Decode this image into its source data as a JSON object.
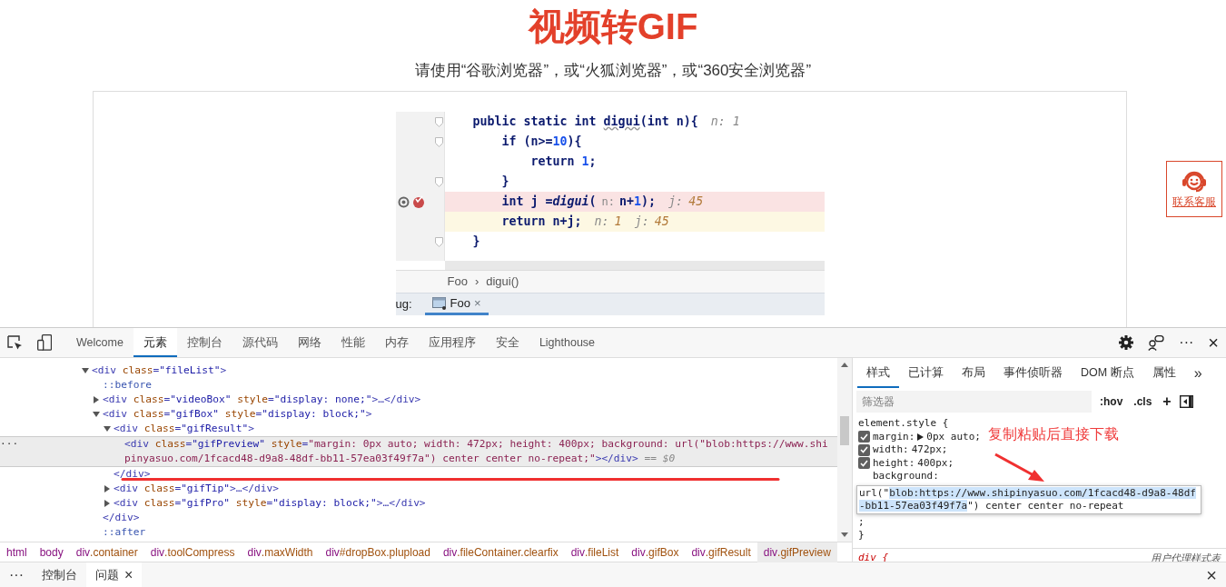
{
  "page": {
    "title": "视频转GIF",
    "subtitle": "请使用“谷歌浏览器”，或“火狐浏览器”，或“360安全浏览器”",
    "contact_label": "联系客服"
  },
  "preview": {
    "code_lines": [
      {
        "kind": "normal",
        "fold": true,
        "segments": [
          {
            "kind": "code",
            "text": "public static int "
          },
          {
            "kind": "squiggle",
            "text": "digui"
          },
          {
            "kind": "code",
            "text": "(int n){"
          },
          {
            "kind": "hint",
            "text": "n: 1"
          }
        ]
      },
      {
        "kind": "normal",
        "fold": true,
        "segments": [
          {
            "kind": "code",
            "text": "    if (n>="
          },
          {
            "kind": "number",
            "text": "10"
          },
          {
            "kind": "code",
            "text": "){"
          }
        ]
      },
      {
        "kind": "normal",
        "fold": false,
        "segments": [
          {
            "kind": "code",
            "text": "        return "
          },
          {
            "kind": "number",
            "text": "1"
          },
          {
            "kind": "code",
            "text": ";"
          }
        ]
      },
      {
        "kind": "normal",
        "fold": true,
        "segments": [
          {
            "kind": "code",
            "text": "    }"
          }
        ]
      },
      {
        "kind": "breakpoint",
        "fold": false,
        "segments": [
          {
            "kind": "code",
            "text": "    int j ="
          },
          {
            "kind": "call",
            "text": "digui"
          },
          {
            "kind": "code",
            "text": "("
          },
          {
            "kind": "param",
            "text": "n:"
          },
          {
            "kind": "code",
            "text": "n+"
          },
          {
            "kind": "number",
            "text": "1"
          },
          {
            "kind": "code",
            "text": ");"
          },
          {
            "kind": "hint",
            "text": "j:"
          },
          {
            "kind": "value",
            "text": "45"
          }
        ]
      },
      {
        "kind": "execution",
        "fold": false,
        "segments": [
          {
            "kind": "code",
            "text": "    return n+j;"
          },
          {
            "kind": "hint",
            "text": "n:"
          },
          {
            "kind": "value",
            "text": "1"
          },
          {
            "kind": "hint",
            "text": "j:"
          },
          {
            "kind": "value",
            "text": "45"
          }
        ]
      },
      {
        "kind": "normal",
        "fold": true,
        "segments": [
          {
            "kind": "code",
            "text": "}"
          }
        ]
      }
    ],
    "breadcrumb": [
      "Foo",
      "digui()"
    ],
    "breadcrumb_separator": "›",
    "tool_label": "ug:",
    "tab": {
      "label": "Foo",
      "close": "×"
    }
  },
  "devtools": {
    "tabs": [
      {
        "label": "Welcome",
        "selected": false
      },
      {
        "label": "元素",
        "selected": true
      },
      {
        "label": "控制台",
        "selected": false
      },
      {
        "label": "源代码",
        "selected": false
      },
      {
        "label": "网络",
        "selected": false
      },
      {
        "label": "性能",
        "selected": false
      },
      {
        "label": "内存",
        "selected": false
      },
      {
        "label": "应用程序",
        "selected": false
      },
      {
        "label": "安全",
        "selected": false
      },
      {
        "label": "Lighthouse",
        "selected": false
      }
    ],
    "more": "···",
    "close": "×",
    "dom_tree": [
      {
        "kind": "element",
        "text": "<div class=\"fileList\">",
        "expanded": true,
        "selected": false,
        "children": [
          {
            "kind": "pseudo",
            "text": "::before",
            "selected": false
          },
          {
            "kind": "element",
            "text": "<div class=\"videoBox\" style=\"display: none;\">…</div>",
            "expanded": false,
            "selected": false
          },
          {
            "kind": "element",
            "text": "<div class=\"gifBox\" style=\"display: block;\">",
            "expanded": true,
            "selected": false,
            "children": [
              {
                "kind": "element",
                "text": "<div class=\"gifResult\">",
                "expanded": true,
                "selected": false,
                "children": [
                  {
                    "kind": "leaf",
                    "text": "<div class=\"gifPreview\" style=\"margin: 0px auto; width: 472px; height: 400px; background: url(\"blob:https://www.shipinyasuo.com/1fcacd48-d9a8-48df-bb11-57ea03f49f7a\") center center no-repeat;\"></div>",
                    "selected": true,
                    "menu": "···",
                    "marker": "== $0"
                  }
                ]
              },
              {
                "kind": "close",
                "text": "</div>",
                "selected": false
              },
              {
                "kind": "element",
                "text": "<div class=\"gifTip\">…</div>",
                "expanded": false,
                "selected": false
              },
              {
                "kind": "element",
                "text": "<div class=\"gifPro\" style=\"display: block;\">…</div>",
                "expanded": false,
                "selected": false
              }
            ]
          },
          {
            "kind": "close",
            "text": "</div>",
            "selected": false
          },
          {
            "kind": "pseudo",
            "text": "::after",
            "selected": false
          }
        ]
      }
    ],
    "breadcrumbs": [
      {
        "label": "html",
        "selected": false
      },
      {
        "label": "body",
        "selected": false
      },
      {
        "label": "div.container",
        "selected": false
      },
      {
        "label": "div.toolCompress",
        "selected": false
      },
      {
        "label": "div.maxWidth",
        "selected": false
      },
      {
        "label": "div#dropBox.plupload",
        "selected": false
      },
      {
        "label": "div.fileContainer.clearfix",
        "selected": false
      },
      {
        "label": "div.fileList",
        "selected": false
      },
      {
        "label": "div.gifBox",
        "selected": false
      },
      {
        "label": "div.gifResult",
        "selected": false
      },
      {
        "label": "div.gifPreview",
        "selected": true
      }
    ],
    "styles": {
      "tabs": [
        {
          "label": "样式",
          "selected": true
        },
        {
          "label": "已计算",
          "selected": false
        },
        {
          "label": "布局",
          "selected": false
        },
        {
          "label": "事件侦听器",
          "selected": false
        },
        {
          "label": "DOM 断点",
          "selected": false
        },
        {
          "label": "属性",
          "selected": false
        }
      ],
      "overflow": "»",
      "filter_placeholder": "筛选器",
      "hov": ":hov",
      "cls": ".cls",
      "add": "+",
      "rule_selector": "element.style {",
      "declarations": [
        {
          "kind": "property",
          "text": "margin:",
          "value": "0px auto;",
          "checked": true,
          "expandable": true
        },
        {
          "kind": "property",
          "text": "width:",
          "value": "472px;",
          "checked": true,
          "expandable": false
        },
        {
          "kind": "property",
          "text": "height:",
          "value": "400px;",
          "checked": true,
          "expandable": false
        },
        {
          "kind": "editing",
          "text": "background:"
        }
      ],
      "editor": {
        "prefix": "url(\"",
        "selected": "blob:https://www.shipinyasuo.com/1fcacd48-d9a8-48df-bb11-57ea03f49f7a",
        "suffix": "\") center center no-repeat"
      },
      "semicolon": ";",
      "rule_close": "}",
      "next_selector": "div {",
      "next_source": "用户代理样式表"
    },
    "drawer": {
      "more": "···",
      "tabs": [
        {
          "label": "控制台",
          "selected": false,
          "closable": false
        },
        {
          "label": "问题",
          "selected": true,
          "closable": true
        }
      ],
      "tab_close": "×",
      "close": "×"
    }
  },
  "annotation": {
    "text": "复制粘贴后直接下载"
  }
}
